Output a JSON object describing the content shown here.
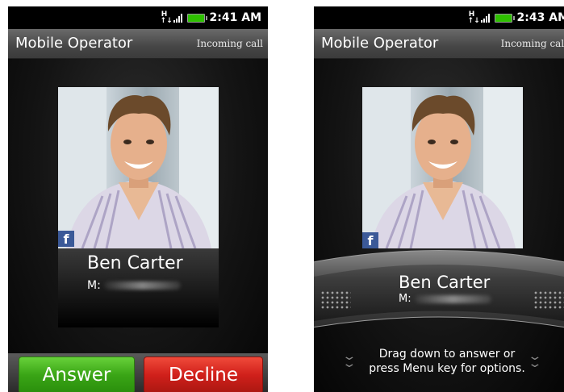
{
  "screens": [
    {
      "status": {
        "time": "2:41 AM",
        "network": "H"
      },
      "header": {
        "operator": "Mobile Operator",
        "call_state": "Incoming call"
      },
      "contact": {
        "name": "Ben  Carter",
        "number_label": "M:",
        "social_badge": "f"
      },
      "actions": {
        "answer": "Answer",
        "decline": "Decline"
      }
    },
    {
      "status": {
        "time": "2:43 AM",
        "network": "H"
      },
      "header": {
        "operator": "Mobile Operator",
        "call_state": "Incoming call"
      },
      "contact": {
        "name": "Ben  Carter",
        "number_label": "M:",
        "social_badge": "f"
      },
      "hint": {
        "line1": "Drag down to answer or",
        "line2": "press Menu key for options."
      }
    }
  ],
  "colors": {
    "answer": "#3aa516",
    "decline": "#d0201b",
    "facebook": "#3b5998",
    "battery": "#2ec000"
  },
  "icons": [
    "network-h-icon",
    "signal-icon",
    "battery-icon",
    "facebook-icon",
    "chevron-down-icon",
    "grip-dots-icon"
  ]
}
